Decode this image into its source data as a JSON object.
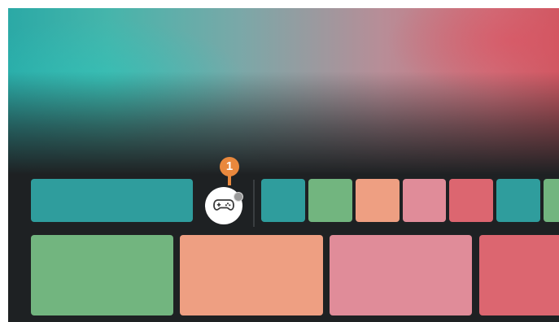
{
  "hero": {
    "icon": "banner-artwork"
  },
  "row1": {
    "featured_tile": {
      "color": "#2f9d9d"
    },
    "game_button": {
      "icon": "gamepad-icon",
      "status_dot": "#9a9a9a"
    },
    "callout": {
      "number": "1",
      "color": "#e9883d"
    },
    "app_tiles": [
      {
        "color": "#2f9d9d"
      },
      {
        "color": "#72b57f"
      },
      {
        "color": "#ee9f82"
      },
      {
        "color": "#e08c99"
      },
      {
        "color": "#dc6670"
      },
      {
        "color": "#2f9d9d"
      },
      {
        "color": "#72b57f"
      }
    ]
  },
  "row2": {
    "content_tiles": [
      {
        "color": "#72b57f"
      },
      {
        "color": "#ee9f82"
      },
      {
        "color": "#e08c99"
      },
      {
        "color": "#dc6670"
      }
    ]
  }
}
